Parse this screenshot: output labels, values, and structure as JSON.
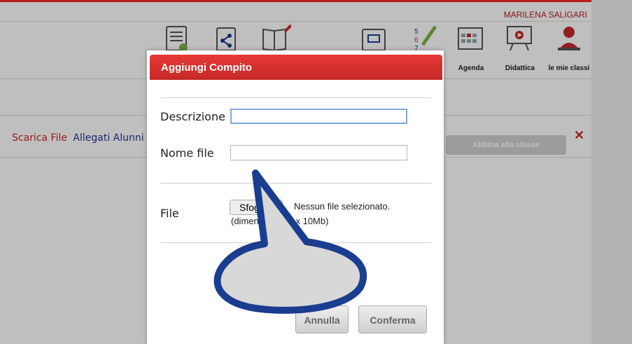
{
  "header": {
    "user_name": "MARILENA SALIGARI"
  },
  "toolbar": {
    "items": [
      {
        "label": "",
        "icon": "document-icon"
      },
      {
        "label": "",
        "icon": "share-icon"
      },
      {
        "label": "",
        "icon": "notebook-icon"
      },
      {
        "label": "",
        "icon": "board-icon"
      },
      {
        "label": "",
        "icon": "register-icon"
      },
      {
        "label": "Agenda",
        "icon": "calendar-icon"
      },
      {
        "label": "Didattica",
        "icon": "presentation-icon"
      },
      {
        "label": "le mie classi",
        "icon": "student-icon"
      }
    ]
  },
  "links": {
    "scarica_file": "Scarica File",
    "allegati_alunni": "Allegati Alunni"
  },
  "actions": {
    "abbina": "Abbina alla classe",
    "close": "✕"
  },
  "modal": {
    "title": "Aggiungi Compito",
    "descrizione_label": "Descrizione",
    "descrizione_value": "",
    "nome_file_label": "Nome file",
    "nome_file_value": "",
    "file_label": "File",
    "browse_button": "Sfoglia...",
    "file_status": "Nessun file selezionato.",
    "file_hint": "(dimensione max 10Mb)",
    "cancel": "Annulla",
    "confirm": "Conferma"
  },
  "colors": {
    "accent": "#c62828",
    "callout": "#1a3d8f"
  }
}
